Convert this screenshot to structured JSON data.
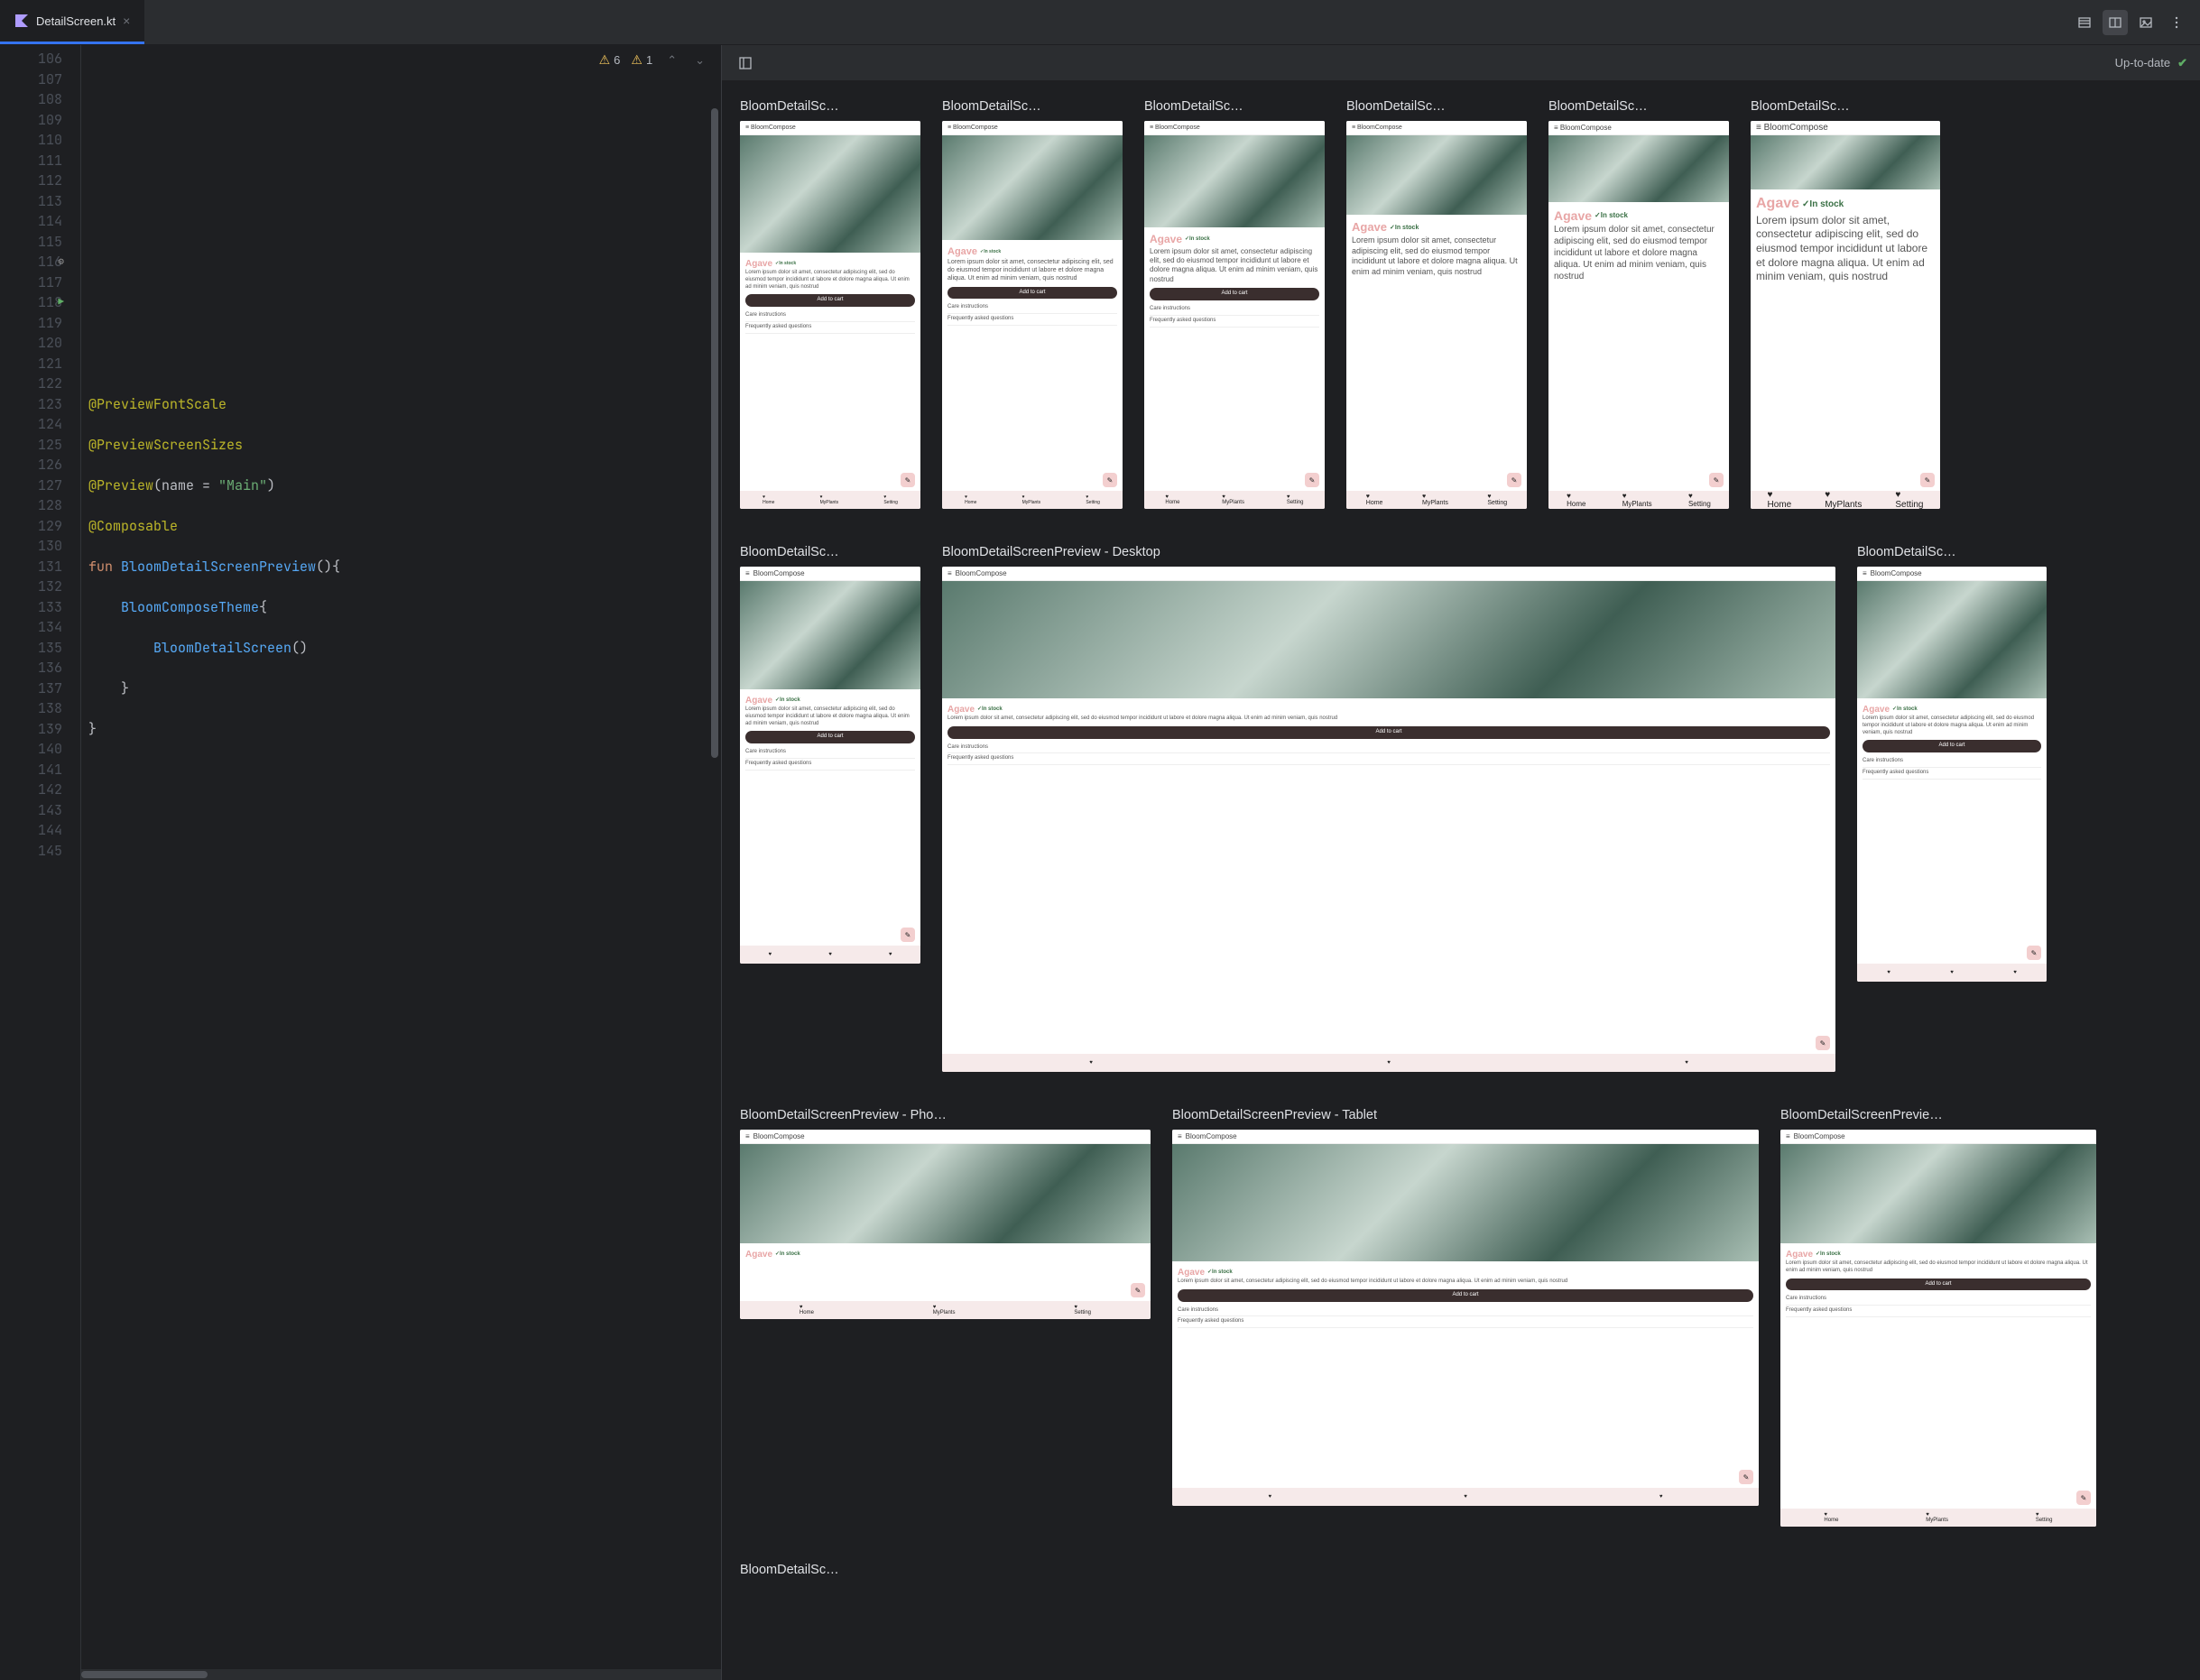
{
  "tab": {
    "icon": "K",
    "title": "DetailScreen.kt",
    "close": "×"
  },
  "toolbar_right": {
    "list_icon": "list",
    "split_icon": "split",
    "image_icon": "image",
    "more_icon": "more"
  },
  "inspection": {
    "warn1_count": "6",
    "warn2_count": "1"
  },
  "editor": {
    "line_start": 106,
    "line_end": 145,
    "icons": {
      "gear_line": 116,
      "run_line": 118
    },
    "code": {
      "l114": "@PreviewFontScale",
      "l115": "@PreviewScreenSizes",
      "l116_a": "@Preview",
      "l116_b": "(name = ",
      "l116_c": "\"Main\"",
      "l116_d": ")",
      "l117": "@Composable",
      "l118_a": "fun ",
      "l118_b": "BloomDetailScreenPreview",
      "l118_c": "(){",
      "l119_a": "    BloomComposeTheme",
      "l119_b": "{",
      "l120_a": "        BloomDetailScreen",
      "l120_b": "()",
      "l121": "    }",
      "l122": "}"
    }
  },
  "preview": {
    "status": "Up-to-date",
    "row1_labels": [
      "BloomDetailSc…",
      "BloomDetailSc…",
      "BloomDetailSc…",
      "BloomDetailSc…",
      "BloomDetailSc…",
      "BloomDetailSc…"
    ],
    "row2": {
      "l0": "BloomDetailSc…",
      "l1": "BloomDetailScreenPreview - Desktop",
      "l2": "BloomDetailSc…"
    },
    "row3": {
      "l0": "BloomDetailScreenPreview - Pho…",
      "l1": "BloomDetailScreenPreview - Tablet",
      "l2": "BloomDetailScreenPrevie…"
    },
    "row4": {
      "l0": "BloomDetailSc…"
    },
    "mock": {
      "app_name": "BloomCompose",
      "plant": "Agave",
      "stock": "In stock",
      "lorem": "Lorem ipsum dolor sit amet, consectetur adipiscing elit, sed do eiusmod tempor incididunt ut labore et dolore magna aliqua. Ut enim ad minim veniam, quis nostrud",
      "addcart": "Add to cart",
      "care": "Care instructions",
      "faq": "Frequently asked questions",
      "nav": [
        "Home",
        "MyPlants",
        "Setting"
      ]
    }
  }
}
